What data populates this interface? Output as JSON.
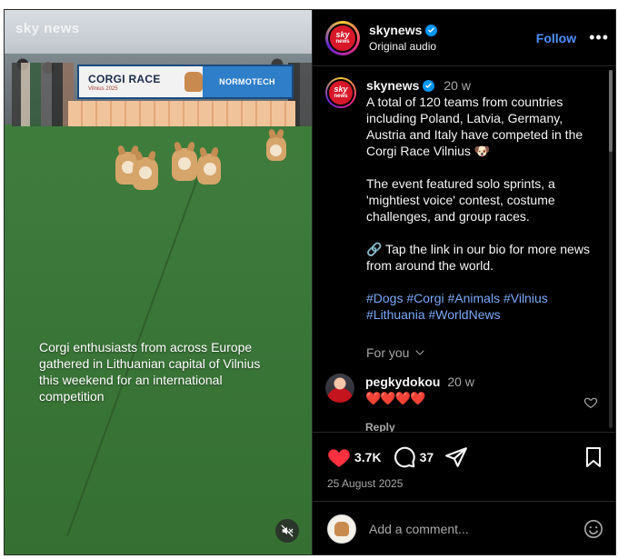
{
  "video": {
    "watermark": "sky news",
    "banner_title": "CORGI RACE",
    "banner_subtitle": "Vilnius 2025",
    "banner_sponsor": "NORMOTECH",
    "caption": "Corgi enthusiasts from across Europe gathered in Lithuanian capital of Vilnius this weekend for an international competition",
    "mute_icon": "speaker-muted-icon"
  },
  "header": {
    "avatar_top": "sky",
    "avatar_bottom": "news",
    "username": "skynews",
    "verified": true,
    "subtitle": "Original audio",
    "follow_label": "Follow",
    "more_label": "•••"
  },
  "post": {
    "username": "skynews",
    "time": "20 w",
    "paragraph_1": "A total of 120 teams from countries including Poland, Latvia, Germany, Austria and Italy have competed in the Corgi Race Vilnius 🐶",
    "paragraph_2": "The event featured solo sprints, a 'mightiest voice' contest, costume challenges, and group races.",
    "paragraph_3": "🔗 Tap the link in our bio for more news from around the world.",
    "hashtags": "#Dogs #Corgi #Animals #Vilnius #Lithuania #WorldNews",
    "for_you_label": "For you"
  },
  "comment": {
    "username": "pegkydokou",
    "time": "20 w",
    "text": "❤️❤️❤️❤️",
    "reply_label": "Reply"
  },
  "actions": {
    "like_count": "3.7K",
    "comment_count": "37",
    "date": "25 August 2025"
  },
  "add_comment": {
    "placeholder": "Add a comment..."
  },
  "colors": {
    "accent_blue": "#4f8ef7",
    "heart_red": "#ff3040",
    "background": "#000000"
  }
}
